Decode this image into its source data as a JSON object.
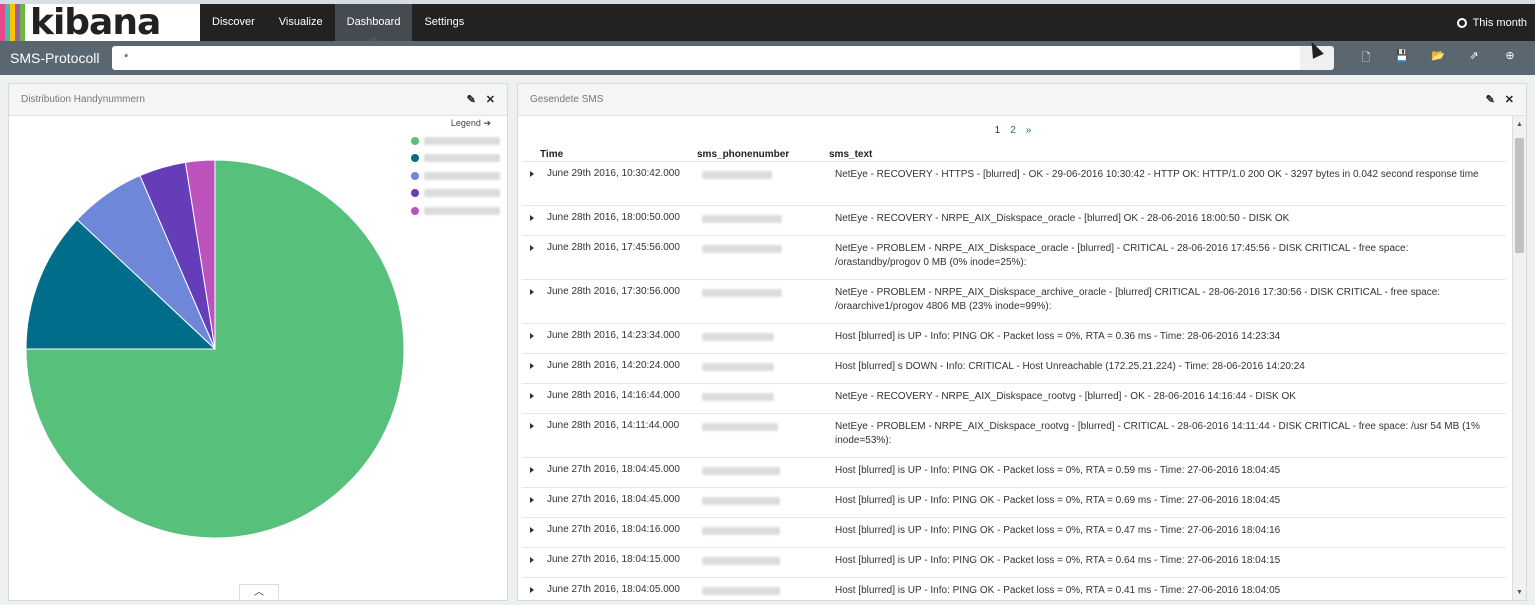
{
  "app": {
    "logo_text": "kibana",
    "stripe_colors": [
      "#e8488b",
      "#3cbeb4",
      "#fdc300",
      "#9d5da3",
      "#6eb442"
    ],
    "nav": [
      {
        "label": "Discover",
        "active": false
      },
      {
        "label": "Visualize",
        "active": false
      },
      {
        "label": "Dashboard",
        "active": true
      },
      {
        "label": "Settings",
        "active": false
      }
    ],
    "timepicker_label": "This month"
  },
  "search": {
    "dashboard_title": "SMS-Protocoll",
    "query": "*"
  },
  "toolbar": {
    "icons": [
      "new-dashboard-icon",
      "save-icon",
      "open-icon",
      "share-icon",
      "add-panel-icon"
    ]
  },
  "pie_panel": {
    "title": "Distribution Handynummern",
    "legend_label": "Legend",
    "chart_data": {
      "type": "pie",
      "values": [
        75,
        12,
        6.5,
        4,
        2.5
      ],
      "colors": [
        "#57c17b",
        "#006e8a",
        "#6f87d8",
        "#663db8",
        "#bc52bc"
      ]
    }
  },
  "sms_panel": {
    "title": "Gesendete SMS",
    "pager": {
      "pages": [
        "1",
        "2"
      ],
      "current": "1",
      "next": "»"
    },
    "columns": [
      "Time",
      "sms_phonenumber",
      "sms_text"
    ],
    "rows": [
      {
        "time": "June 29th 2016, 10:30:42.000",
        "text": "NetEye - RECOVERY - HTTPS - [blurred] - OK - 29-06-2016 10:30:42 - HTTP OK: HTTP/1.0 200 OK - 3297 bytes in 0.042 second response time"
      },
      {
        "time": "June 28th 2016, 18:00:50.000",
        "text": "NetEye - RECOVERY - NRPE_AIX_Diskspace_oracle - [blurred] OK - 28-06-2016 18:00:50 - DISK OK"
      },
      {
        "time": "June 28th 2016, 17:45:56.000",
        "text": "NetEye - PROBLEM - NRPE_AIX_Diskspace_oracle - [blurred] - CRITICAL - 28-06-2016 17:45:56 - DISK CRITICAL - free space: /orastandby/progov 0 MB (0% inode=25%):"
      },
      {
        "time": "June 28th 2016, 17:30:56.000",
        "text": "NetEye - PROBLEM - NRPE_AIX_Diskspace_archive_oracle - [blurred] CRITICAL - 28-06-2016 17:30:56 - DISK CRITICAL - free space: /oraarchive1/progov 4806 MB (23% inode=99%):"
      },
      {
        "time": "June 28th 2016, 14:23:34.000",
        "text": "Host [blurred] is UP - Info: PING OK - Packet loss = 0%, RTA = 0.36 ms - Time: 28-06-2016 14:23:34"
      },
      {
        "time": "June 28th 2016, 14:20:24.000",
        "text": "Host [blurred] s DOWN - Info: CRITICAL - Host Unreachable (172.25.21.224) - Time: 28-06-2016 14:20:24"
      },
      {
        "time": "June 28th 2016, 14:16:44.000",
        "text": "NetEye - RECOVERY - NRPE_AIX_Diskspace_rootvg - [blurred] - OK - 28-06-2016 14:16:44 - DISK OK"
      },
      {
        "time": "June 28th 2016, 14:11:44.000",
        "text": "NetEye - PROBLEM - NRPE_AIX_Diskspace_rootvg - [blurred] - CRITICAL - 28-06-2016 14:11:44 - DISK CRITICAL - free space: /usr 54 MB (1% inode=53%):"
      },
      {
        "time": "June 27th 2016, 18:04:45.000",
        "text": "Host [blurred] is UP - Info: PING OK - Packet loss = 0%, RTA = 0.59 ms - Time: 27-06-2016 18:04:45"
      },
      {
        "time": "June 27th 2016, 18:04:45.000",
        "text": "Host [blurred] is UP - Info: PING OK - Packet loss = 0%, RTA = 0.69 ms - Time: 27-06-2016 18:04:45"
      },
      {
        "time": "June 27th 2016, 18:04:16.000",
        "text": "Host [blurred] is UP - Info: PING OK - Packet loss = 0%, RTA = 0.47 ms - Time: 27-06-2016 18:04:16"
      },
      {
        "time": "June 27th 2016, 18:04:15.000",
        "text": "Host [blurred] is UP - Info: PING OK - Packet loss = 0%, RTA = 0.64 ms - Time: 27-06-2016 18:04:15"
      },
      {
        "time": "June 27th 2016, 18:04:05.000",
        "text": "Host [blurred] is UP - Info: PING OK - Packet loss = 0%, RTA = 0.41 ms - Time: 27-06-2016 18:04:05"
      }
    ]
  }
}
